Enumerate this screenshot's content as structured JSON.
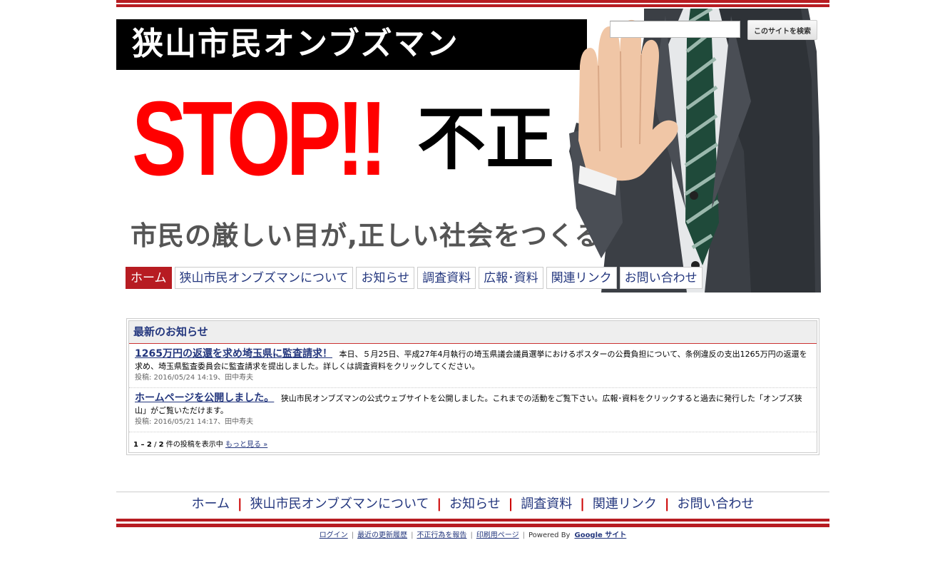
{
  "header": {
    "site_title": "狭山市民オンブズマン",
    "stop_text": "STOP!!",
    "fusei_text": "不正",
    "tagline": "市民の厳しい目が,正しい社会をつくる。"
  },
  "search": {
    "value": "",
    "button_label": "このサイトを検索"
  },
  "nav": {
    "items": [
      {
        "label": "ホーム",
        "active": true
      },
      {
        "label": "狭山市民オンブズマンについて"
      },
      {
        "label": "お知らせ"
      },
      {
        "label": "調査資料"
      },
      {
        "label": "広報･資料"
      },
      {
        "label": "関連リンク"
      },
      {
        "label": "お問い合わせ"
      }
    ]
  },
  "news": {
    "heading": "最新のお知らせ",
    "items": [
      {
        "title": "1265万円の返還を求め埼玉県に監査請求！",
        "body": "本日、５月25日、平成27年4月執行の埼玉県議会議員選挙におけるポスターの公費負担について、条例違反の支出1265万円の返還を求め、埼玉県監査委員会に監査請求を提出しました。詳しくは調査資料をクリックしてください。",
        "meta": "投稿: 2016/05/24 14:19、田中寿夫"
      },
      {
        "title": "ホームページを公開しました。",
        "body": "狭山市民オンブズマンの公式ウェブサイトを公開しました。これまでの活動をご覧下さい。広報･資料をクリックすると過去に発行した「オンブズ狭山」がご覧いただけます。",
        "meta": "投稿: 2016/05/21 14:17、田中寿夫"
      }
    ],
    "footer_range": "1 – 2",
    "footer_total": "2",
    "footer_text": "件の投稿を表示中",
    "more_link": "もっと見る »"
  },
  "footer_nav": {
    "items": [
      "ホーム",
      "狭山市民オンブズマンについて",
      "お知らせ",
      "調査資料",
      "関連リンク",
      "お問い合わせ"
    ],
    "separator": "|"
  },
  "site_footer": {
    "links": [
      "ログイン",
      "最近の更新履歴",
      "不正行為を報告",
      "印刷用ページ"
    ],
    "powered_by": "Powered By",
    "google_sites": "Google サイト"
  },
  "colors": {
    "brand_red": "#b71c22",
    "link_blue": "#24377e"
  }
}
